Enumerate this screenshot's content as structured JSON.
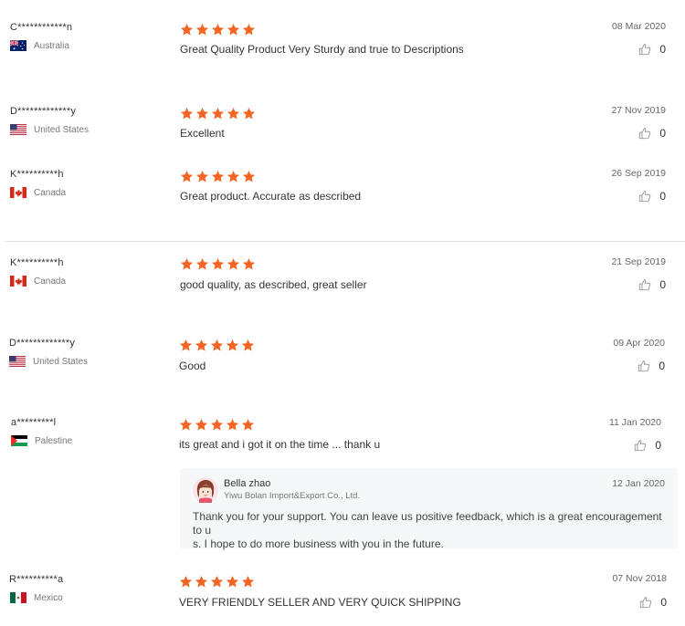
{
  "reviews": [
    {
      "name": "C************n",
      "country": "Australia",
      "flag": "au",
      "rating": 5,
      "text": "Great Quality Product Very Sturdy and true to Descriptions",
      "date": "08 Mar 2020",
      "helpful": "0"
    },
    {
      "name": "D*************y",
      "country": "United States",
      "flag": "us",
      "rating": 5,
      "text": "Excellent",
      "date": "27 Nov 2019",
      "helpful": "0"
    },
    {
      "name": "K**********h",
      "country": "Canada",
      "flag": "ca",
      "rating": 5,
      "text": "Great product. Accurate as described",
      "date": "26 Sep 2019",
      "helpful": "0"
    },
    {
      "name": "K**********h",
      "country": "Canada",
      "flag": "ca",
      "rating": 5,
      "text": "good quality, as described, great seller",
      "date": "21 Sep 2019",
      "helpful": "0"
    },
    {
      "name": "D*************y",
      "country": "United States",
      "flag": "us",
      "rating": 5,
      "text": "Good",
      "date": "09 Apr 2020",
      "helpful": "0"
    },
    {
      "name": "a*********l",
      "country": "Palestine",
      "flag": "ps",
      "rating": 5,
      "text": "its great and i got it on the time ... thank u",
      "date": "11 Jan 2020",
      "helpful": "0"
    },
    {
      "name": "R**********a",
      "country": "Mexico",
      "flag": "mx",
      "rating": 5,
      "text": "VERY FRIENDLY SELLER AND VERY QUICK SHIPPING",
      "date": "07 Nov 2018",
      "helpful": "0"
    }
  ],
  "seller_reply": {
    "name": "Bella zhao",
    "company": "Yiwu Bolan Import&Export Co., Ltd.",
    "date": "12 Jan 2020",
    "text_line1": "Thank you for your support. You can leave us positive feedback, which is a great encouragement to u",
    "text_line2": "s. I hope to do more business with you in the future."
  },
  "colors": {
    "star": "#f26522",
    "text": "#333333",
    "muted": "#777777",
    "reply_bg": "#f5f7f9",
    "divider": "#e2e2e2"
  },
  "icons": {
    "star": "star-icon",
    "helpful": "thumbs-up-icon",
    "avatar": "seller-avatar"
  }
}
